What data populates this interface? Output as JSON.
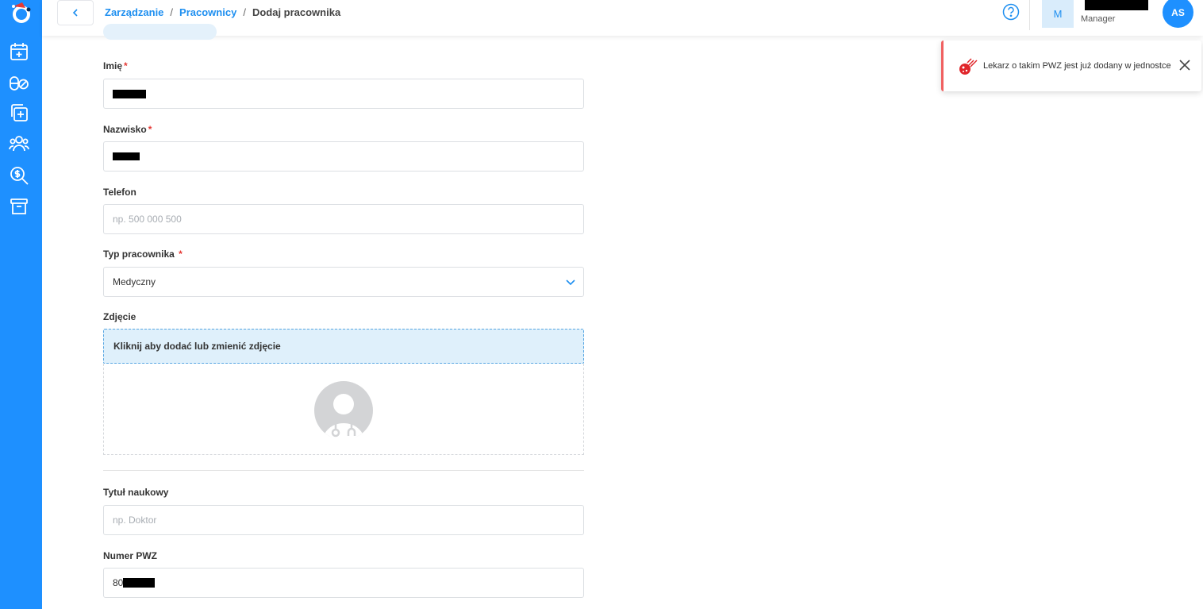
{
  "header": {
    "breadcrumb": [
      "Zarządzanie",
      "Pracownicy",
      "Dodaj pracownika"
    ],
    "breadcrumb_separator": "/",
    "user_initial": "M",
    "user_role": "Manager",
    "avatar_initials": "AS"
  },
  "sidebar": {
    "items": [
      "calendar-add-icon",
      "pills-icon",
      "medical-copy-icon",
      "users-icon",
      "finance-search-icon",
      "archive-icon"
    ]
  },
  "form": {
    "first_name": {
      "label": "Imię",
      "required": "*",
      "value": ""
    },
    "last_name": {
      "label": "Nazwisko",
      "required": "*",
      "value": ""
    },
    "phone": {
      "label": "Telefon",
      "placeholder": "np. 500 000 500"
    },
    "employee_type": {
      "label": "Typ pracownika",
      "required": "*",
      "value": "Medyczny"
    },
    "photo": {
      "label": "Zdjęcie",
      "prompt": "Kliknij aby dodać lub zmienić zdjęcie"
    },
    "academic_title": {
      "label": "Tytuł naukowy",
      "placeholder": "np. Doktor"
    },
    "pwz": {
      "label": "Numer PWZ",
      "value_prefix": "80"
    }
  },
  "toast": {
    "message": "Lekarz o takim PWZ jest już dodany w jednostce",
    "accent_color": "#f06060"
  },
  "colors": {
    "primary": "#1e90ff",
    "link": "#1e8ff0",
    "required": "#e53935"
  }
}
